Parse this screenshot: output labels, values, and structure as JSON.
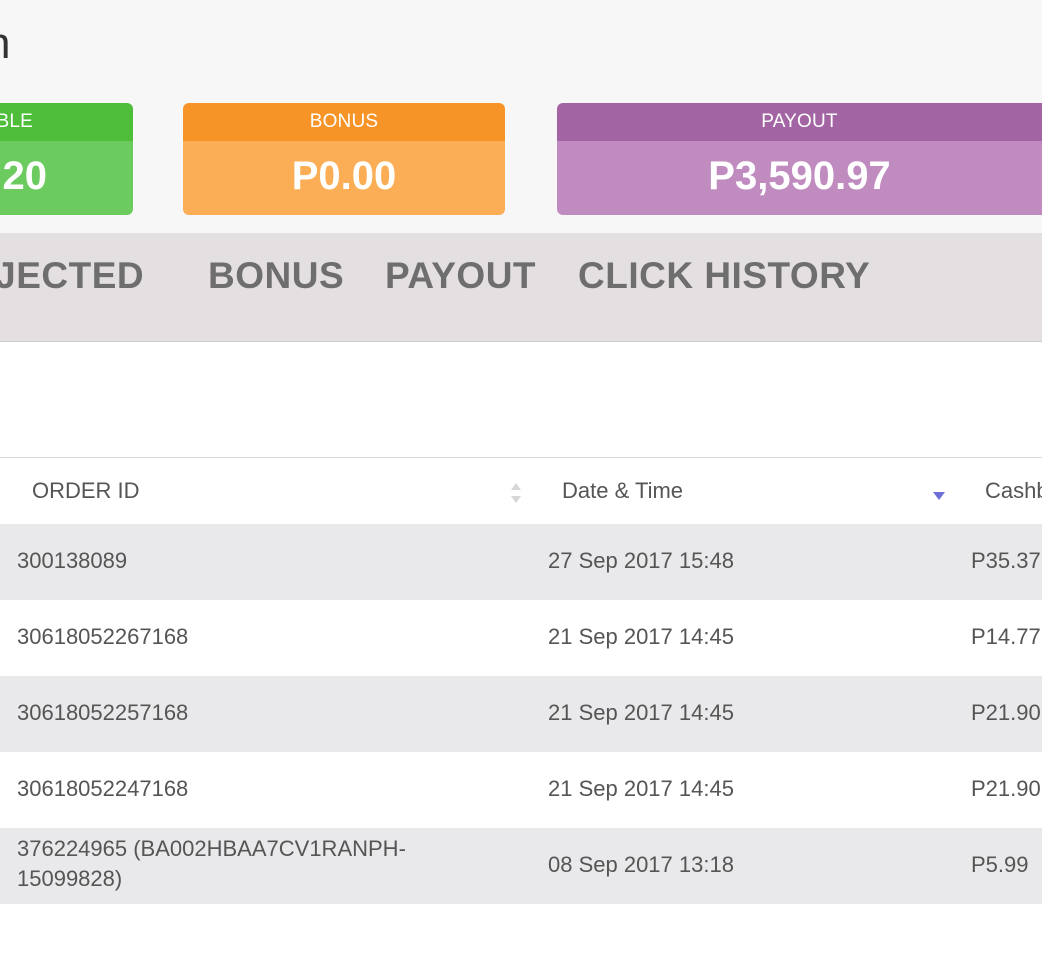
{
  "page": {
    "title": "n"
  },
  "cards": {
    "available": {
      "label": "BLE",
      "value": "20",
      "color": "#4dbd3a"
    },
    "bonus": {
      "label": "BONUS",
      "value": "P0.00",
      "color": "#f79428"
    },
    "payout": {
      "label": "PAYOUT",
      "value": "P3,590.97",
      "color": "#a364a3"
    }
  },
  "tabs": [
    "EJECTED",
    "BONUS",
    "PAYOUT",
    "CLICK HISTORY"
  ],
  "table": {
    "headers": {
      "order_id": "ORDER ID",
      "date_time": "Date & Time",
      "cashback": "Cashb"
    },
    "sort": {
      "order_id": "unsorted",
      "date_time": "descending"
    },
    "rows": [
      {
        "order_id": "300138089",
        "date_time": "27 Sep 2017 15:48",
        "cashback": "P35.37"
      },
      {
        "order_id": "30618052267168",
        "date_time": "21 Sep 2017 14:45",
        "cashback": "P14.77"
      },
      {
        "order_id": "30618052257168",
        "date_time": "21 Sep 2017 14:45",
        "cashback": "P21.90"
      },
      {
        "order_id": "30618052247168",
        "date_time": "21 Sep 2017 14:45",
        "cashback": "P21.90"
      },
      {
        "order_id": "376224965 (BA002HBAA7CV1RANPH-15099828)",
        "date_time": "08 Sep 2017 13:18",
        "cashback": "P5.99"
      }
    ]
  }
}
